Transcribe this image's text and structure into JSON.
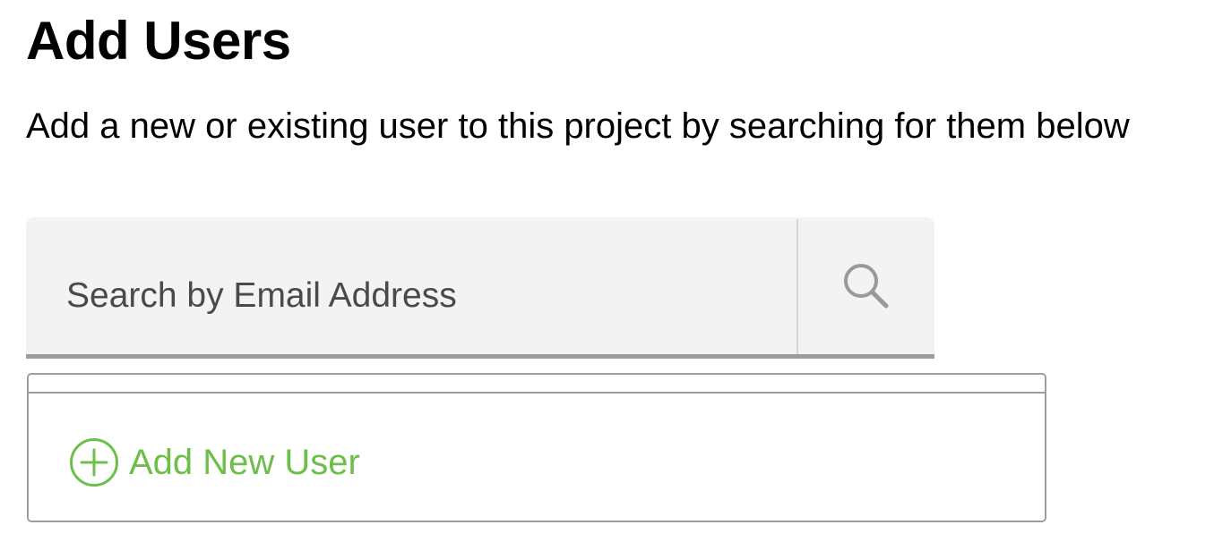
{
  "header": {
    "title": "Add Users",
    "subtitle": "Add a new or existing user to this project by searching for them below"
  },
  "search": {
    "placeholder": "Search by Email Address",
    "value": "",
    "button_icon": "search-icon"
  },
  "dropdown": {
    "add_new_user_label": "Add New User",
    "add_new_user_icon": "plus-circle-icon"
  },
  "colors": {
    "accent_green": "#6cc04a",
    "search_background": "#f3f3f3",
    "border_gray": "#9e9e9e"
  }
}
